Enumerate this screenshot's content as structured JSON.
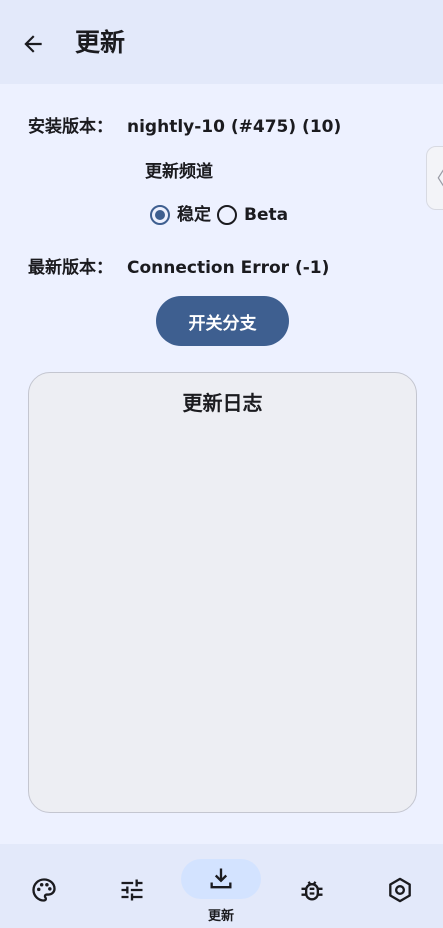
{
  "app_bar": {
    "title": "更新",
    "back_icon": "arrow-left-icon"
  },
  "installed": {
    "label": "安装版本：",
    "value": "nightly-10 (#475) (10)"
  },
  "channel": {
    "title": "更新频道",
    "options": [
      {
        "label": "稳定",
        "selected": true
      },
      {
        "label": "Beta",
        "selected": false
      }
    ]
  },
  "latest": {
    "label": "最新版本：",
    "value": "Connection Error (-1)"
  },
  "toggle_branch_label": "开关分支",
  "changelog": {
    "title": "更新日志"
  },
  "edge_handle": {
    "glyph": "〈"
  },
  "bottom_nav": {
    "items": [
      {
        "icon": "palette-icon",
        "label": ""
      },
      {
        "icon": "tune-icon",
        "label": ""
      },
      {
        "icon": "download-icon",
        "label": "更新",
        "active": true
      },
      {
        "icon": "bug-icon",
        "label": ""
      },
      {
        "icon": "settings-hexagon-icon",
        "label": ""
      }
    ]
  },
  "colors": {
    "primary": "#3e5f90",
    "background": "#edf1ff",
    "app_bar": "#e3e9fa",
    "active_indicator": "#d3e3ff",
    "card": "#edeef3"
  }
}
